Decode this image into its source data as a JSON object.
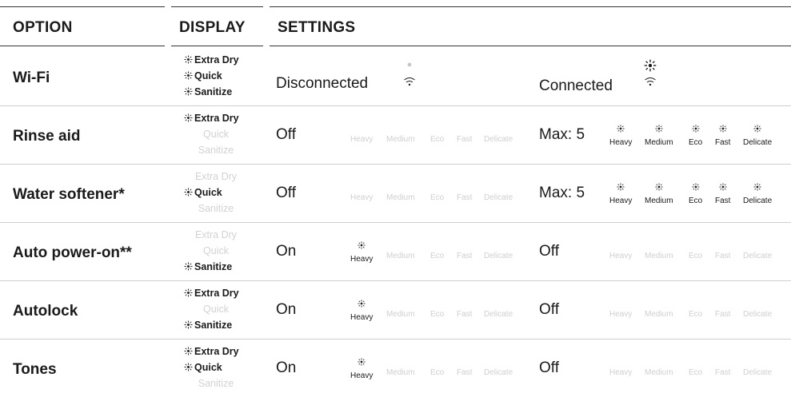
{
  "header": {
    "option": "OPTION",
    "display": "DISPLAY",
    "settings": "SETTINGS"
  },
  "display_items": [
    "Extra Dry",
    "Quick",
    "Sanitize"
  ],
  "programs": [
    "Heavy",
    "Medium",
    "Eco",
    "Fast",
    "Delicate"
  ],
  "rows": [
    {
      "option": "Wi-Fi",
      "display_lit": [
        true,
        true,
        true
      ],
      "left": {
        "state": "Disconnected",
        "icon": "wifi-indicator-off-icon"
      },
      "right": {
        "state": "Connected",
        "icon": "wifi-indicator-on-icon"
      }
    },
    {
      "option": "Rinse aid",
      "display_lit": [
        true,
        false,
        false
      ],
      "left": {
        "state": "Off",
        "programs_lit": [
          false,
          false,
          false,
          false,
          false
        ]
      },
      "right": {
        "state": "Max: 5",
        "programs_lit": [
          true,
          true,
          true,
          true,
          true
        ]
      }
    },
    {
      "option": "Water softener*",
      "display_lit": [
        false,
        true,
        false
      ],
      "left": {
        "state": "Off",
        "programs_lit": [
          false,
          false,
          false,
          false,
          false
        ]
      },
      "right": {
        "state": "Max: 5",
        "programs_lit": [
          true,
          true,
          true,
          true,
          true
        ]
      }
    },
    {
      "option": "Auto power-on**",
      "display_lit": [
        false,
        false,
        true
      ],
      "left": {
        "state": "On",
        "programs_lit": [
          true,
          false,
          false,
          false,
          false
        ]
      },
      "right": {
        "state": "Off",
        "programs_lit": [
          false,
          false,
          false,
          false,
          false
        ]
      }
    },
    {
      "option": "Autolock",
      "display_lit": [
        true,
        false,
        true
      ],
      "left": {
        "state": "On",
        "programs_lit": [
          true,
          false,
          false,
          false,
          false
        ]
      },
      "right": {
        "state": "Off",
        "programs_lit": [
          false,
          false,
          false,
          false,
          false
        ]
      }
    },
    {
      "option": "Tones",
      "display_lit": [
        true,
        true,
        false
      ],
      "left": {
        "state": "On",
        "programs_lit": [
          true,
          false,
          false,
          false,
          false
        ]
      },
      "right": {
        "state": "Off",
        "programs_lit": [
          false,
          false,
          false,
          false,
          false
        ]
      }
    }
  ],
  "colors": {
    "text": "#1a1a1a",
    "inactive": "#cfcfcf",
    "rule": "#333333"
  }
}
